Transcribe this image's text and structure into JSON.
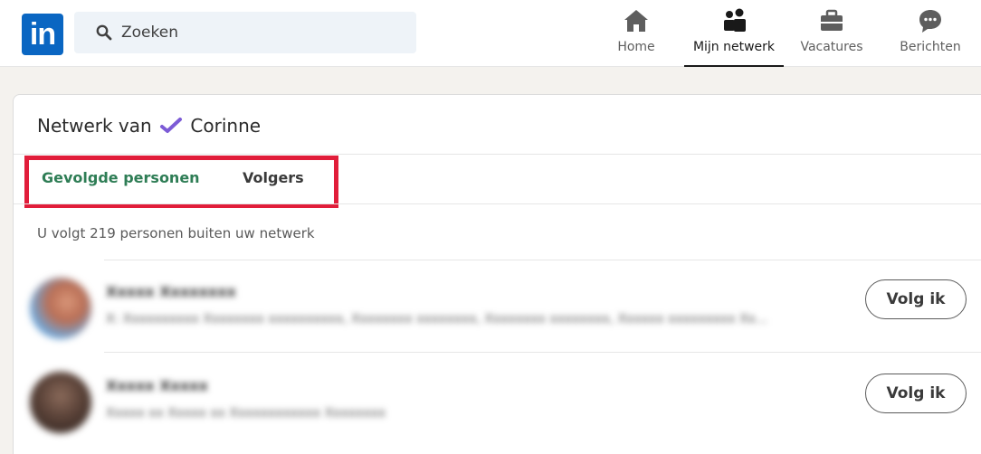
{
  "nav": {
    "search_placeholder": "Zoeken",
    "items": [
      {
        "label": "Home",
        "icon": "home-icon"
      },
      {
        "label": "Mijn netwerk",
        "icon": "network-icon"
      },
      {
        "label": "Vacatures",
        "icon": "briefcase-icon"
      },
      {
        "label": "Berichten",
        "icon": "messaging-icon"
      }
    ]
  },
  "card": {
    "title_prefix": "Netwerk van",
    "title_name": "Corinne",
    "tabs": [
      {
        "label": "Gevolgde personen",
        "active": true
      },
      {
        "label": "Volgers",
        "active": false
      }
    ],
    "following_count_text": "U volgt 219 personen buiten uw netwerk",
    "people": [
      {
        "name": "Xxxxx Xxxxxxxx",
        "headline": "X: Xxxxxxxxxx Xxxxxxxx xxxxxxxxxx, Xxxxxxxx xxxxxxxx, Xxxxxxxx xxxxxxxx, Xxxxxx xxxxxxxxx Xx...",
        "button": "Volg ik"
      },
      {
        "name": "Xxxxx Xxxxx",
        "headline": "Xxxxx xx Xxxxx xx Xxxxxxxxxxxx Xxxxxxxx",
        "button": "Volg ik"
      }
    ]
  },
  "colors": {
    "brand": "#0a66c2",
    "active_tab": "#2e7d55",
    "highlight": "#e11d3a",
    "check": "#7c5bd6"
  }
}
